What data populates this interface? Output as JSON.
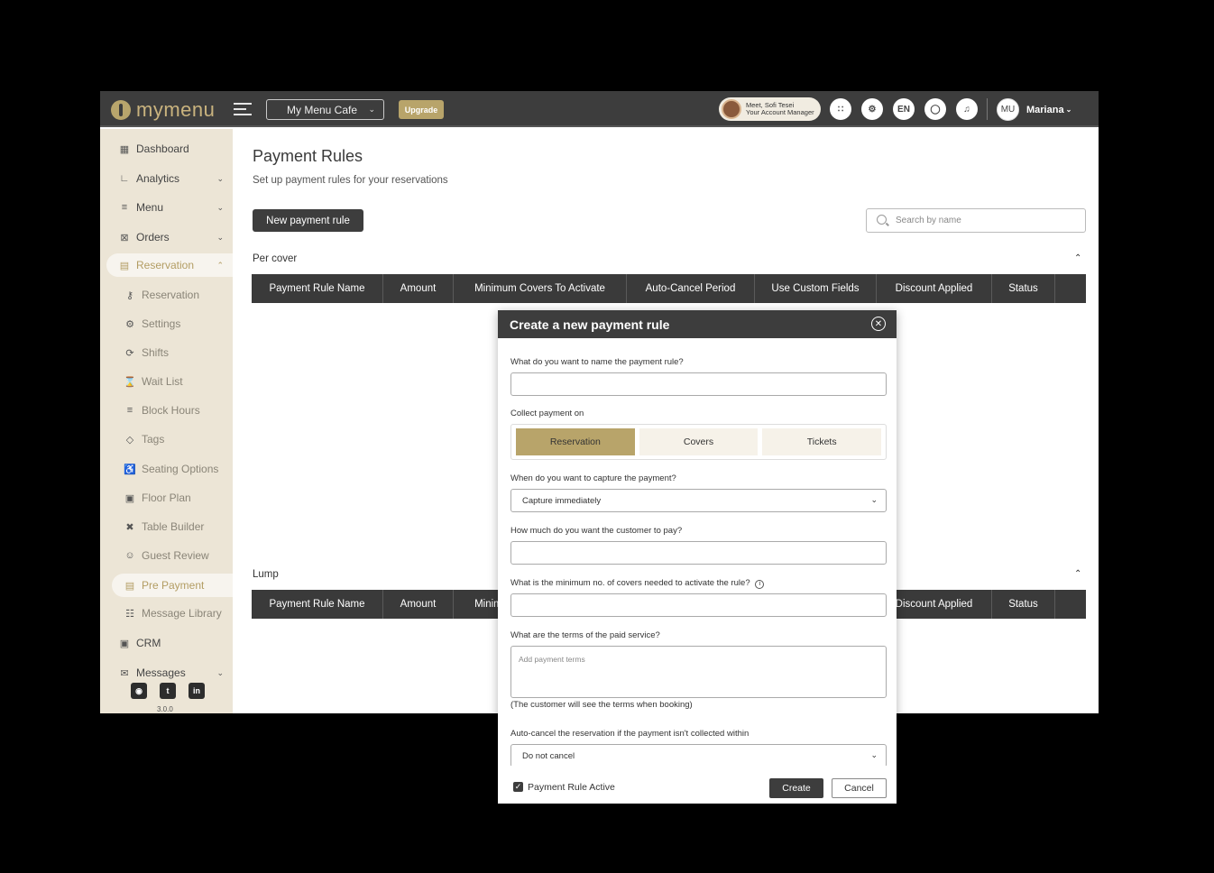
{
  "topbar": {
    "logo_text": "mymenu",
    "cafe_select": "My Menu Cafe",
    "upgrade_label": "Upgrade",
    "manager_line1": "Meet, Sofi Tesei",
    "manager_line2": "Your Account Manager",
    "lang": "EN",
    "user_initials": "MU",
    "user_name": "Mariana"
  },
  "sidebar": {
    "items": [
      {
        "label": "Dashboard",
        "icon": "dashboard-icon"
      },
      {
        "label": "Analytics",
        "icon": "analytics-icon"
      },
      {
        "label": "Menu",
        "icon": "menu-icon"
      },
      {
        "label": "Orders",
        "icon": "orders-icon"
      },
      {
        "label": "Reservation",
        "icon": "reservation-icon"
      },
      {
        "label": "Reservation",
        "icon": "cutlery-icon"
      },
      {
        "label": "Settings",
        "icon": "gear-icon"
      },
      {
        "label": "Shifts",
        "icon": "shifts-icon"
      },
      {
        "label": "Wait List",
        "icon": "hourglass-icon"
      },
      {
        "label": "Block Hours",
        "icon": "block-hours-icon"
      },
      {
        "label": "Tags",
        "icon": "tag-icon"
      },
      {
        "label": "Seating Options",
        "icon": "seating-icon"
      },
      {
        "label": "Floor Plan",
        "icon": "floor-plan-icon"
      },
      {
        "label": "Table Builder",
        "icon": "table-builder-icon"
      },
      {
        "label": "Guest Review",
        "icon": "guest-review-icon"
      },
      {
        "label": "Pre Payment",
        "icon": "pre-payment-icon"
      },
      {
        "label": "Message Library",
        "icon": "message-library-icon"
      },
      {
        "label": "CRM",
        "icon": "crm-icon"
      },
      {
        "label": "Messages",
        "icon": "messages-icon"
      }
    ],
    "version": "3.0.0"
  },
  "main": {
    "title": "Payment Rules",
    "subtitle": "Set up payment rules for your reservations",
    "new_button": "New payment rule",
    "search_placeholder": "Search by name",
    "sections": [
      {
        "label": "Per cover"
      },
      {
        "label": "Lump"
      }
    ],
    "columns": [
      "Payment Rule Name",
      "Amount",
      "Minimum Covers To Activate",
      "Auto-Cancel Period",
      "Use Custom Fields",
      "Discount Applied",
      "Status"
    ]
  },
  "modal": {
    "title": "Create a new payment rule",
    "q_name": "What do you want to name the payment rule?",
    "q_collect": "Collect payment on",
    "segments": [
      "Reservation",
      "Covers",
      "Tickets"
    ],
    "q_capture": "When do you want to capture the payment?",
    "capture_value": "Capture immediately",
    "q_amount": "How much do you want the customer to pay?",
    "q_min_covers": "What is the minimum no. of covers needed to activate the rule?",
    "q_terms": "What are the terms of the paid service?",
    "terms_placeholder": "Add payment terms",
    "terms_note": "(The customer will see the terms when booking)",
    "q_autocancel": "Auto-cancel the reservation if the payment isn't collected within",
    "autocancel_value": "Do not cancel",
    "active_label": "Payment Rule Active",
    "create_label": "Create",
    "cancel_label": "Cancel"
  }
}
